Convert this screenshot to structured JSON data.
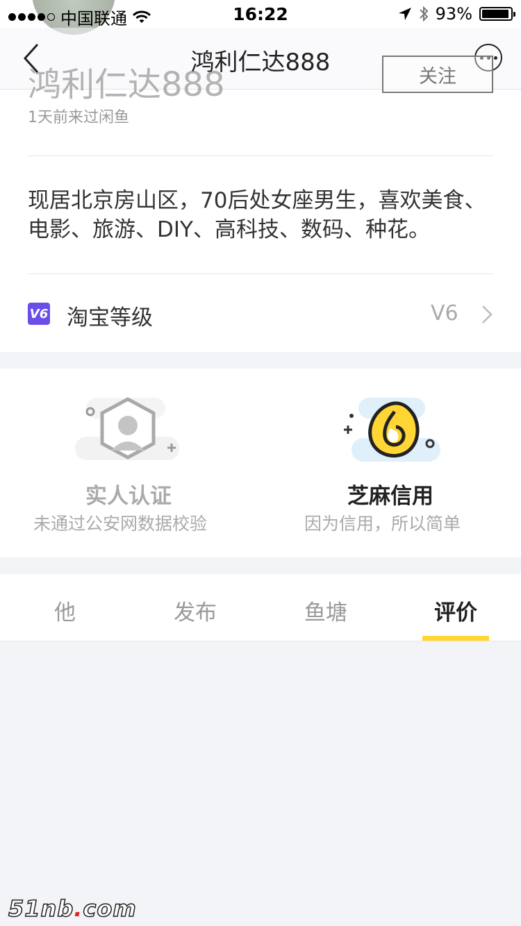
{
  "status_bar": {
    "carrier": "中国联通",
    "time": "16:22",
    "battery": "93%"
  },
  "nav": {
    "title": "鸿利仁达888"
  },
  "profile": {
    "name": "鸿利仁达888",
    "follow_label": "关注",
    "last_visit": "1天前来过闲鱼",
    "bio": "现居北京房山区，70后处女座男生，喜欢美食、电影、旅游、DIY、高科技、数码、种花。",
    "taobao_badge": "V6",
    "taobao_label": "淘宝等级",
    "taobao_level": "V6"
  },
  "certifications": [
    {
      "title": "实人认证",
      "subtitle": "未通过公安网数据校验",
      "icon": "person-verify-icon"
    },
    {
      "title": "芝麻信用",
      "subtitle": "因为信用，所以简单",
      "icon": "sesame-credit-icon"
    }
  ],
  "tabs": [
    {
      "label": "他"
    },
    {
      "label": "发布"
    },
    {
      "label": "鱼塘"
    },
    {
      "label": "评价",
      "active": true
    }
  ],
  "watermark": {
    "text": "51nb",
    "dot": ".",
    "suffix": "com"
  },
  "colors": {
    "accent_yellow": "#ffd633",
    "badge_purple": "#6b4ee8"
  }
}
